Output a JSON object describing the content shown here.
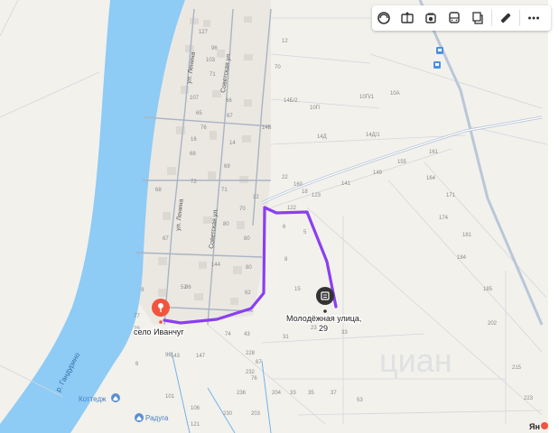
{
  "streets": {
    "lenina_top": "ул. Ленина",
    "sovetskaya_top": "Советская ул.",
    "lenina_bottom": "ул. Ленина",
    "sovetskaya_bottom": "Советская ул.",
    "river": "р. Гандурино"
  },
  "places": {
    "start_pin_label": "село Иванчуг",
    "dest_pin_label": "Молодёжная улица,\n29",
    "dest_line1": "Молодёжная улица,",
    "dest_line2": "29",
    "kottedzh": "Коттедж",
    "raduga": "Радуга"
  },
  "watermark": "циан",
  "corner_logo": "Ян",
  "house_numbers": [
    "127",
    "12",
    "96",
    "103",
    "71",
    "70",
    "107",
    "66",
    "65",
    "67",
    "76",
    "14Б/2",
    "10П",
    "10П/1",
    "10А",
    "14Б",
    "14Д/1",
    "14Д",
    "16",
    "14",
    "68",
    "69",
    "72",
    "71",
    "68",
    "70",
    "67",
    "80",
    "80",
    "52",
    "62",
    "32",
    "122",
    "123",
    "141",
    "149",
    "155",
    "161",
    "164",
    "171",
    "174",
    "181",
    "184",
    "185",
    "202",
    "215",
    "223",
    "6",
    "5",
    "8",
    "15",
    "23",
    "31",
    "33",
    "43",
    "228",
    "232",
    "236",
    "230",
    "203",
    "204",
    "33",
    "35",
    "37",
    "53",
    "76",
    "67",
    "77",
    "29",
    "25",
    "143",
    "147",
    "96",
    "101",
    "106",
    "121",
    "160",
    "18",
    "22",
    "6",
    "9",
    "86",
    "80",
    "144",
    "74",
    "1"
  ],
  "colors": {
    "route": "#8a3ff2",
    "river": "#8ecbf5",
    "start_pin": "#f2543d",
    "dest_pin": "#333333",
    "transit_icon": "#4a90e2"
  },
  "toolbar": [
    "layers-icon",
    "panorama-icon",
    "camera-icon",
    "bus-icon",
    "copy-icon",
    "ruler-icon",
    "more-icon"
  ]
}
